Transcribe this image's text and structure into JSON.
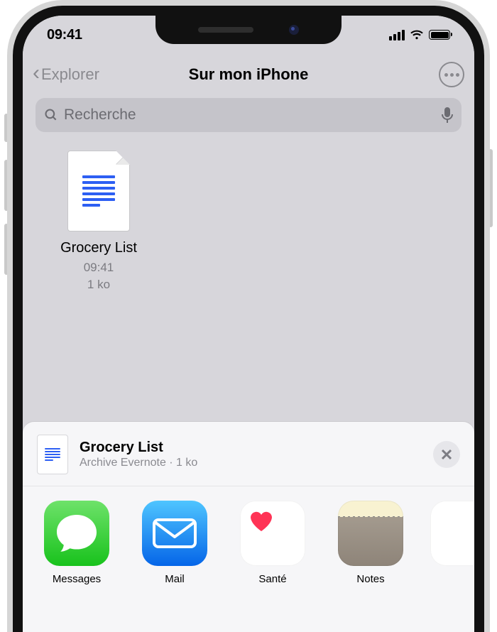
{
  "status": {
    "time": "09:41"
  },
  "nav": {
    "back_label": "Explorer",
    "title": "Sur mon iPhone"
  },
  "search": {
    "placeholder": "Recherche"
  },
  "file": {
    "name": "Grocery List",
    "time": "09:41",
    "size": "1 ko"
  },
  "sheet": {
    "title": "Grocery List",
    "subtitle": "Archive Evernote · 1 ko",
    "apps": [
      {
        "label": "Messages"
      },
      {
        "label": "Mail"
      },
      {
        "label": "Santé"
      },
      {
        "label": "Notes"
      }
    ]
  }
}
